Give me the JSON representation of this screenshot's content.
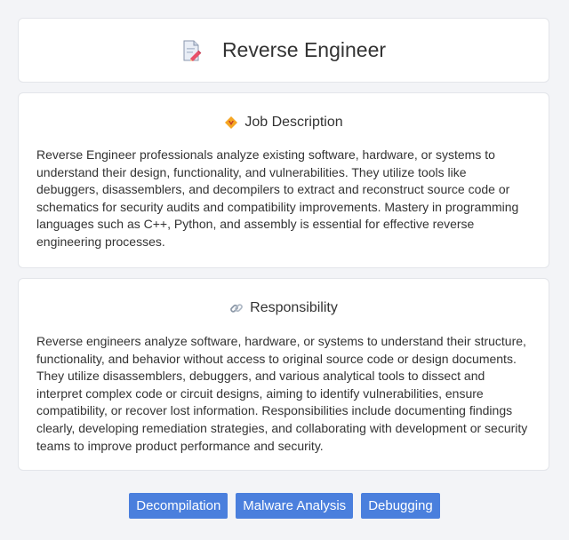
{
  "header": {
    "title": "Reverse Engineer",
    "icon": "document-pencil-icon"
  },
  "job_description": {
    "heading": "Job Description",
    "icon": "diamond-badge-icon",
    "text": "Reverse Engineer professionals analyze existing software, hardware, or systems to understand their design, functionality, and vulnerabilities. They utilize tools like debuggers, disassemblers, and decompilers to extract and reconstruct source code or schematics for security audits and compatibility improvements. Mastery in programming languages such as C++, Python, and assembly is essential for effective reverse engineering processes."
  },
  "responsibility": {
    "heading": "Responsibility",
    "icon": "link-icon",
    "text": "Reverse engineers analyze software, hardware, or systems to understand their structure, functionality, and behavior without access to original source code or design documents. They utilize disassemblers, debuggers, and various analytical tools to dissect and interpret complex code or circuit designs, aiming to identify vulnerabilities, ensure compatibility, or recover lost information. Responsibilities include documenting findings clearly, developing remediation strategies, and collaborating with development or security teams to improve product performance and security."
  },
  "tags": [
    "Decompilation",
    "Malware Analysis",
    "Debugging"
  ],
  "colors": {
    "tag_background": "#4a7fdd",
    "page_background": "#f3f4f7"
  }
}
